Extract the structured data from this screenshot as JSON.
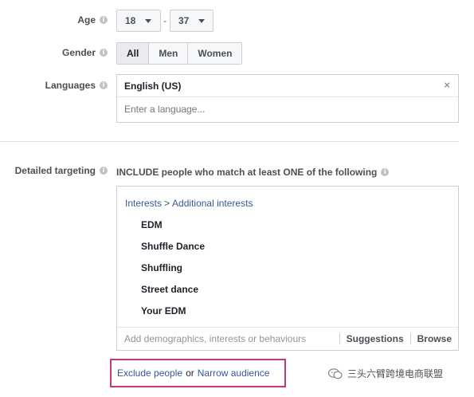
{
  "age": {
    "label": "Age",
    "min": "18",
    "max": "37",
    "separator": "-"
  },
  "gender": {
    "label": "Gender",
    "options": [
      "All",
      "Men",
      "Women"
    ],
    "selected": "All"
  },
  "languages": {
    "label": "Languages",
    "selected": "English (US)",
    "remove": "×",
    "placeholder": "Enter a language..."
  },
  "detailed_targeting": {
    "label": "Detailed targeting",
    "include_text": "INCLUDE people who match at least ONE of the following",
    "breadcrumb": {
      "part1": "Interests",
      "separator": ">",
      "part2": "Additional interests"
    },
    "interests": [
      "EDM",
      "Shuffle Dance",
      "Shuffling",
      "Street dance",
      "Your EDM"
    ],
    "input_placeholder": "Add demographics, interests or behaviours",
    "suggestions_label": "Suggestions",
    "browse_label": "Browse"
  },
  "footer_links": {
    "exclude": "Exclude people",
    "or": "or",
    "narrow": "Narrow audience"
  },
  "watermark": {
    "text": "三头六臂跨境电商联盟",
    "icon": "wechat-icon"
  },
  "colors": {
    "link": "#365899",
    "highlight_border": "#c0397b",
    "border": "#ccd0d5"
  }
}
